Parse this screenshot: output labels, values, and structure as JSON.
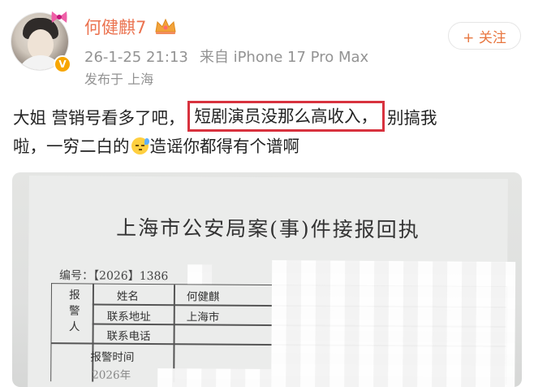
{
  "user": {
    "name": "何健麒7",
    "verified_badge": "V",
    "avatar": "profile-photo",
    "crown_icon": "crown-icon",
    "decoration_icon": "pink-bow-icon"
  },
  "post_meta": {
    "time": "26-1-25 21:13",
    "source": "来自 iPhone 17 Pro Max",
    "location": "发布于 上海"
  },
  "follow_button": {
    "label": "+ 关注"
  },
  "content": {
    "part1": "大姐 营销号看多了吧，",
    "highlight": "短剧演员没那么高收入，",
    "part2": "别搞我",
    "part3": "啦，一穷二白的",
    "emoji": "sweat-emoji",
    "part4": "造谣你都得有个谱啊"
  },
  "image": {
    "doc_title": "上海市公安局案(事)件接报回执",
    "number_label": "编号：【2026】1386",
    "reporter_label": "报警人",
    "name_label": "姓名",
    "name_value": "何健麒",
    "address_label": "联系地址",
    "address_value": "上海市",
    "phone_label": "联系电话",
    "report_time_label": "报警时间",
    "report_time_value": "2026年"
  },
  "colors": {
    "username": "#eb7350",
    "meta": "#939393",
    "follow": "#e8763f",
    "highlight_border": "#d8323e"
  }
}
